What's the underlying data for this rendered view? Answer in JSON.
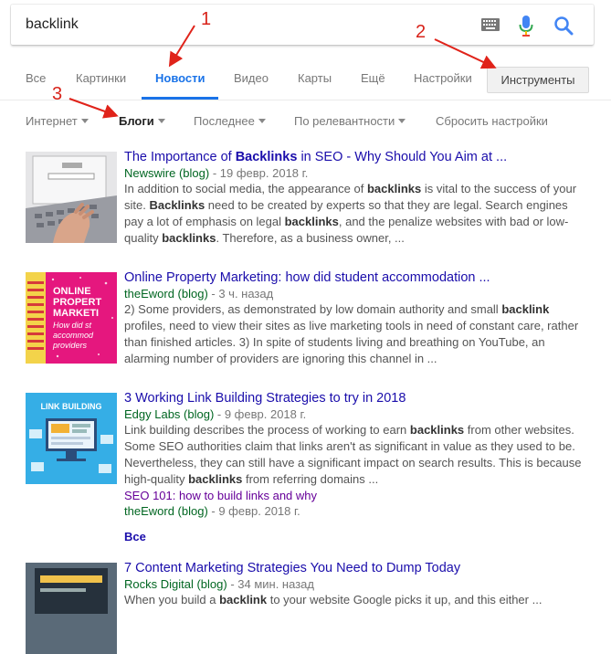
{
  "search": {
    "query": "backlink"
  },
  "tabs": [
    {
      "label": "Все"
    },
    {
      "label": "Картинки"
    },
    {
      "label": "Новости"
    },
    {
      "label": "Видео"
    },
    {
      "label": "Карты"
    },
    {
      "label": "Ещё"
    },
    {
      "label": "Настройки"
    }
  ],
  "tools_label": "Инструменты",
  "filters": [
    {
      "label": "Интернет"
    },
    {
      "label": "Блоги"
    },
    {
      "label": "Последнее"
    },
    {
      "label": "По релевантности"
    },
    {
      "label": "Сбросить настройки"
    }
  ],
  "annotations": [
    "1",
    "2",
    "3"
  ],
  "results": [
    {
      "title_pre": "The Importance of ",
      "title_bold": "Backlinks",
      "title_post": " in SEO - Why Should You Aim at ...",
      "site": "Newswire (blog)",
      "date": " - 19 февр. 2018 г.",
      "snippet_html": "In addition to social media, the appearance of <b>backlinks</b> is vital to the success of your site. <b>Backlinks</b> need to be created by experts so that they are legal. Search engines pay a lot of emphasis on legal <b>backlinks</b>, and the penalize websites with bad or low- quality <b>backlinks</b>. Therefore, as a business owner, ..."
    },
    {
      "title_pre": "Online Property Marketing: how did student accommodation ...",
      "title_bold": "",
      "title_post": "",
      "site": "theEword (blog)",
      "date": " - 3 ч. назад",
      "snippet_html": "2) Some providers, as demonstrated by low domain authority and small <b>backlink</b> profiles, need to view their sites as live marketing tools in need of constant care, rather than finished articles. 3) In spite of students living and breathing on YouTube, an alarming number of providers are ignoring this channel in ...",
      "thumb_text": [
        "ONLINE",
        "PROPERT",
        "MARKETI",
        "How did st",
        "accommod",
        "providers"
      ]
    },
    {
      "title_pre": "3 Working Link Building Strategies to try in 2018",
      "title_bold": "",
      "title_post": "",
      "site": "Edgy Labs (blog)",
      "date": " - 9 февр. 2018 г.",
      "snippet_html": "Link building describes the process of working to earn <b>backlinks</b> from other websites. Some SEO authorities claim that links aren't as significant in value as they used to be. Nevertheless, they can still have a significant impact on search results. This is because high-quality <b>backlinks</b> from referring domains ...",
      "thumb_text": [
        "LINK BUILDING"
      ],
      "sub_title": "SEO 101: how to build links and why",
      "sub_site": "theEword (blog)",
      "sub_date": " - 9 февр. 2018 г.",
      "all_label": "Все"
    },
    {
      "title_pre": "7 Content Marketing Strategies You Need to Dump Today",
      "title_bold": "",
      "title_post": "",
      "site": "Rocks Digital (blog)",
      "date": " - 34 мин. назад",
      "snippet_html": "When you build a <b>backlink</b> to your website Google picks it up, and this either ..."
    }
  ]
}
